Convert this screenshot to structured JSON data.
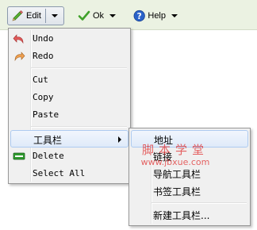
{
  "toolbar": {
    "edit_label": "Edit",
    "ok_label": "Ok",
    "help_label": "Help"
  },
  "edit_menu": {
    "items": [
      {
        "label": "Undo",
        "icon": "undo-icon"
      },
      {
        "label": "Redo",
        "icon": "redo-icon"
      },
      {
        "label": "Cut"
      },
      {
        "label": "Copy"
      },
      {
        "label": "Paste"
      },
      {
        "label": "工具栏",
        "submenu": true
      },
      {
        "label": "Delete",
        "icon": "delete-icon"
      },
      {
        "label": "Select All"
      }
    ]
  },
  "toolbar_submenu": {
    "items": [
      {
        "label": "地址"
      },
      {
        "label": "链接"
      },
      {
        "label": "导航工具栏"
      },
      {
        "label": "书签工具栏"
      },
      {
        "label": "新建工具栏..."
      }
    ]
  },
  "watermark": {
    "line1": "脚本学堂",
    "line2": "www.jbxue.com"
  },
  "colors": {
    "toolbar_bg": "#ebf2e2",
    "menu_bg": "#f0f0f0",
    "hover_border": "#aecbf0",
    "watermark": "#e03030"
  }
}
